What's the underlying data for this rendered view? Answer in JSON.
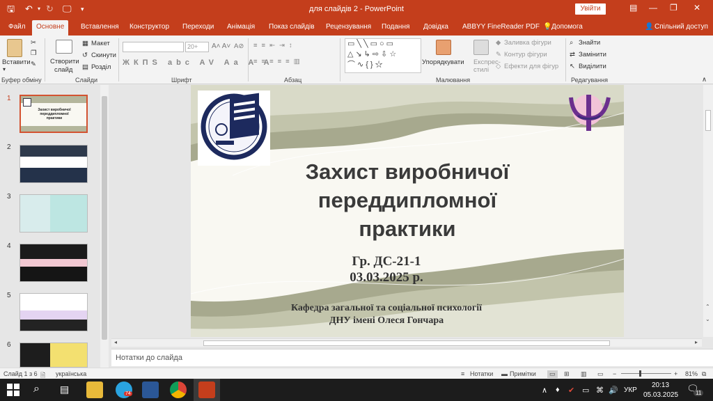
{
  "app": {
    "doc_title": "для слайдів 2  -  PowerPoint",
    "signin": "Увійти"
  },
  "tabs": [
    "Файл",
    "Основне",
    "Вставлення",
    "Конструктор",
    "Переходи",
    "Анімація",
    "Показ слайдів",
    "Рецензування",
    "Подання",
    "Довідка",
    "ABBYY FineReader PDF",
    "Допомога",
    "Спільний доступ"
  ],
  "ribbon": {
    "paste": "Вставити",
    "new_slide_1": "Створити",
    "new_slide_2": "слайд",
    "layout": "Макет",
    "reset": "Скинути",
    "section": "Розділ",
    "font_name": "",
    "font_size": "20+",
    "arrange": "Упорядкувати",
    "express_1": "Експрес-",
    "express_2": "стилі",
    "fill": "Заливка фігури",
    "outline": "Контур фігури",
    "effects": "Ефекти для фігур",
    "find": "Знайти",
    "replace": "Замінити",
    "select": "Виділити",
    "groups": [
      "Буфер обміну",
      "Слайди",
      "Шрифт",
      "Абзац",
      "Малювання",
      "Редагування"
    ]
  },
  "slides": [
    "1",
    "2",
    "3",
    "4",
    "5",
    "6"
  ],
  "thumb1": {
    "line1": "Захист виробничої",
    "line2": "переддипломної",
    "line3": "практики"
  },
  "slide": {
    "title_line1": "Захист виробничої",
    "title_line2": "переддипломної",
    "title_line3": "практики",
    "group": "Гр. ДС-21-1",
    "date": "03.03.2025 р.",
    "dept_line1": "Кафедра загальної та соціальної психології",
    "dept_line2": "ДНУ імені Олеся Гончара"
  },
  "notes_placeholder": "Нотатки до слайда",
  "status": {
    "slide_count": "Слайд 1 з 6",
    "language": "українська",
    "notes": "Нотатки",
    "comments": "Примітки",
    "zoom": "81%"
  },
  "taskbar": {
    "lang": "УКР",
    "time": "20:13",
    "date": "05.03.2025",
    "notif": "11",
    "tg_badge": "74"
  },
  "colors": {
    "accent": "#c43e1c",
    "slide_olive": "#a7a98e",
    "slide_bg": "#f9f8f2"
  }
}
